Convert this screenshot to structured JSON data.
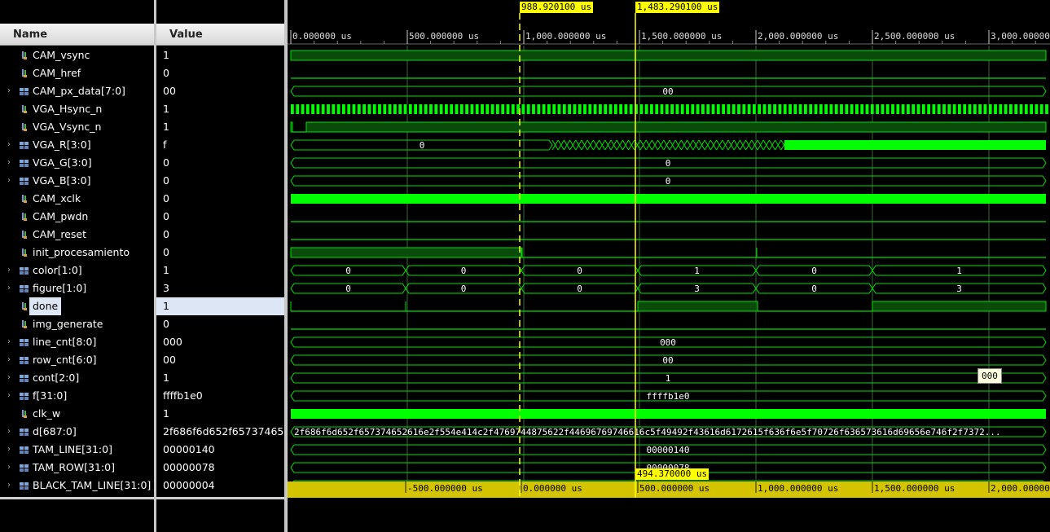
{
  "headers": {
    "name": "Name",
    "value": "Value"
  },
  "signals": [
    {
      "name": "CAM_vsync",
      "value": "1",
      "kind": "bit"
    },
    {
      "name": "CAM_href",
      "value": "0",
      "kind": "bit"
    },
    {
      "name": "CAM_px_data[7:0]",
      "value": "00",
      "kind": "bus"
    },
    {
      "name": "VGA_Hsync_n",
      "value": "1",
      "kind": "bit"
    },
    {
      "name": "VGA_Vsync_n",
      "value": "1",
      "kind": "bit"
    },
    {
      "name": "VGA_R[3:0]",
      "value": "f",
      "kind": "bus"
    },
    {
      "name": "VGA_G[3:0]",
      "value": "0",
      "kind": "bus"
    },
    {
      "name": "VGA_B[3:0]",
      "value": "0",
      "kind": "bus"
    },
    {
      "name": "CAM_xclk",
      "value": "0",
      "kind": "bit"
    },
    {
      "name": "CAM_pwdn",
      "value": "0",
      "kind": "bit"
    },
    {
      "name": "CAM_reset",
      "value": "0",
      "kind": "bit"
    },
    {
      "name": "init_procesamiento",
      "value": "0",
      "kind": "bit"
    },
    {
      "name": "color[1:0]",
      "value": "1",
      "kind": "bus"
    },
    {
      "name": "figure[1:0]",
      "value": "3",
      "kind": "bus"
    },
    {
      "name": "done",
      "value": "1",
      "kind": "bit",
      "selected": true
    },
    {
      "name": "img_generate",
      "value": "0",
      "kind": "bit"
    },
    {
      "name": "line_cnt[8:0]",
      "value": "000",
      "kind": "bus"
    },
    {
      "name": "row_cnt[6:0]",
      "value": "00",
      "kind": "bus"
    },
    {
      "name": "cont[2:0]",
      "value": "1",
      "kind": "bus"
    },
    {
      "name": "f[31:0]",
      "value": "ffffb1e0",
      "kind": "bus"
    },
    {
      "name": "clk_w",
      "value": "1",
      "kind": "bit"
    },
    {
      "name": "d[687:0]",
      "value": "2f686f6d652f65737465",
      "kind": "bus"
    },
    {
      "name": "TAM_LINE[31:0]",
      "value": "00000140",
      "kind": "bus"
    },
    {
      "name": "TAM_ROW[31:0]",
      "value": "00000078",
      "kind": "bus"
    },
    {
      "name": "BLACK_TAM_LINE[31:0]",
      "value": "00000004",
      "kind": "bus"
    }
  ],
  "time_ruler": {
    "ticks": [
      "0.000000 us",
      "500.000000 us",
      "1,000.000000 us",
      "1,500.000000 us",
      "2,000.000000 us",
      "2,500.000000 us",
      "3,000.000000"
    ]
  },
  "delta_ruler": {
    "ticks": [
      "-500.000000 us",
      "0.000000 us",
      "500.000000 us",
      "1,000.000000 us",
      "1,500.000000 us",
      "2,000.00000"
    ]
  },
  "cursors": {
    "cursor1": "988.920100 us",
    "cursor2": "1,483.290100 us",
    "delta": "494.370000 us"
  },
  "bus_labels": {
    "cam_px_data": "00",
    "vga_r": "0",
    "vga_g": "0",
    "vga_b": "0",
    "color": [
      "0",
      "0",
      "0",
      "1",
      "0",
      "1"
    ],
    "figure": [
      "0",
      "0",
      "0",
      "3",
      "0",
      "3"
    ],
    "line_cnt": "000",
    "row_cnt": "00",
    "cont": "1",
    "f": "ffffb1e0",
    "d": "2f686f6d652f657374652616e2f554e414c2f4769744875622f44696769746616c5f49492f43616d6172615f636f6e5f70726f636573616d69656e746f2f7372...",
    "tam_line": "00000140",
    "tam_row": "00000078"
  },
  "tooltip": "000",
  "colors": {
    "wave": "#00e000",
    "bright": "#00ff00",
    "grid": "#3a6a3a",
    "cursor": "#ffff00",
    "bg": "#000000"
  }
}
